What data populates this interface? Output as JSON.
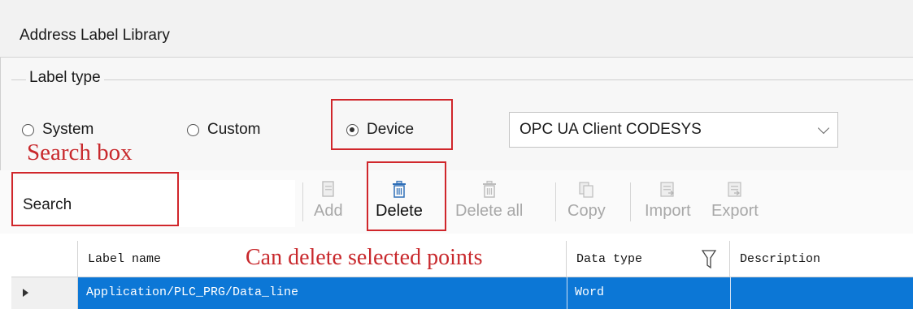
{
  "window": {
    "title": "Address Label Library"
  },
  "label_type": {
    "group_title": "Label type",
    "options": [
      {
        "label": "System",
        "checked": false
      },
      {
        "label": "Custom",
        "checked": false
      },
      {
        "label": "Device",
        "checked": true
      }
    ],
    "device_select": {
      "value": "OPC UA Client CODESYS"
    }
  },
  "toolbar": {
    "search_label": "Search",
    "buttons": [
      {
        "label": "Add",
        "enabled": false,
        "icon": "add-icon"
      },
      {
        "label": "Delete",
        "enabled": true,
        "icon": "trash-icon"
      },
      {
        "label": "Delete all",
        "enabled": false,
        "icon": "trash-all-icon"
      },
      {
        "label": "Copy",
        "enabled": false,
        "icon": "copy-icon"
      },
      {
        "label": "Import",
        "enabled": false,
        "icon": "import-icon"
      },
      {
        "label": "Export",
        "enabled": false,
        "icon": "export-icon"
      }
    ]
  },
  "table": {
    "columns": [
      "Label name",
      "Data type",
      "Description"
    ],
    "rows": [
      {
        "label_name": "Application/PLC_PRG/Data_line",
        "data_type": "Word",
        "description": "",
        "selected": true
      }
    ]
  },
  "annotations": {
    "search_box": "Search box",
    "delete_note": "Can delete selected points"
  },
  "colors": {
    "selection": "#0c77d6",
    "annotation": "#d0262b"
  }
}
